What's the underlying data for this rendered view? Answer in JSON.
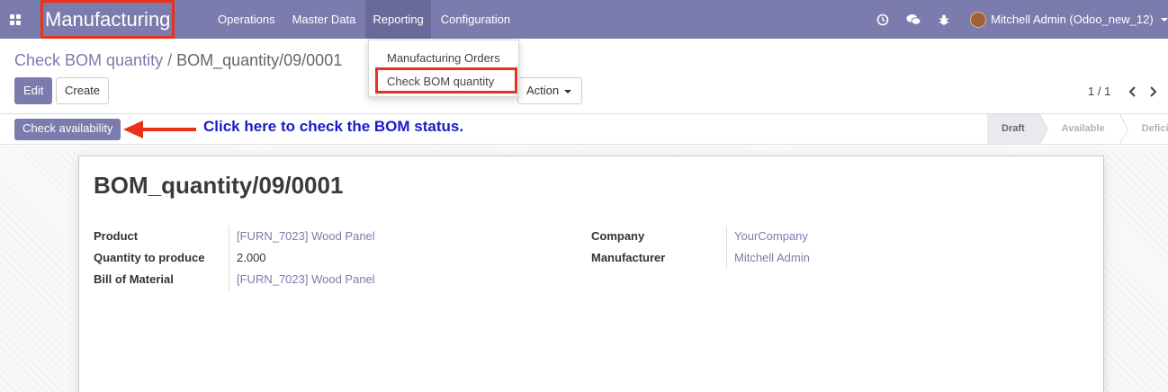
{
  "navbar": {
    "app_name": "Manufacturing",
    "menu": [
      "Operations",
      "Master Data",
      "Reporting",
      "Configuration"
    ],
    "user_name": "Mitchell Admin (Odoo_new_12)"
  },
  "reporting_dropdown": {
    "items": [
      "Manufacturing Orders",
      "Check BOM quantity"
    ]
  },
  "breadcrumb": {
    "parent": "Check BOM quantity",
    "separator": "/",
    "current": "BOM_quantity/09/0001"
  },
  "buttons": {
    "edit": "Edit",
    "create": "Create",
    "action": "Action",
    "check_availability": "Check availability"
  },
  "pager": {
    "value": "1 / 1"
  },
  "annotation": "Click here to check the BOM status.",
  "status_stages": [
    "Draft",
    "Available",
    "Deficient"
  ],
  "record": {
    "title": "BOM_quantity/09/0001",
    "left_fields": [
      {
        "label": "Product",
        "value": "[FURN_7023] Wood Panel"
      },
      {
        "label": "Quantity to produce",
        "value": "2.000"
      },
      {
        "label": "Bill of Material",
        "value": "[FURN_7023] Wood Panel"
      }
    ],
    "right_fields": [
      {
        "label": "Company",
        "value": "YourCompany"
      },
      {
        "label": "Manufacturer",
        "value": "Mitchell Admin"
      }
    ]
  },
  "colors": {
    "brand": "#7c7bad",
    "highlight": "#e8321c",
    "annotation": "#1a1acb"
  },
  "icons": [
    "apps-icon",
    "clock-icon",
    "chat-icon",
    "bug-icon",
    "avatar",
    "chevron-left-icon",
    "chevron-right-icon",
    "arrow-left-icon"
  ]
}
